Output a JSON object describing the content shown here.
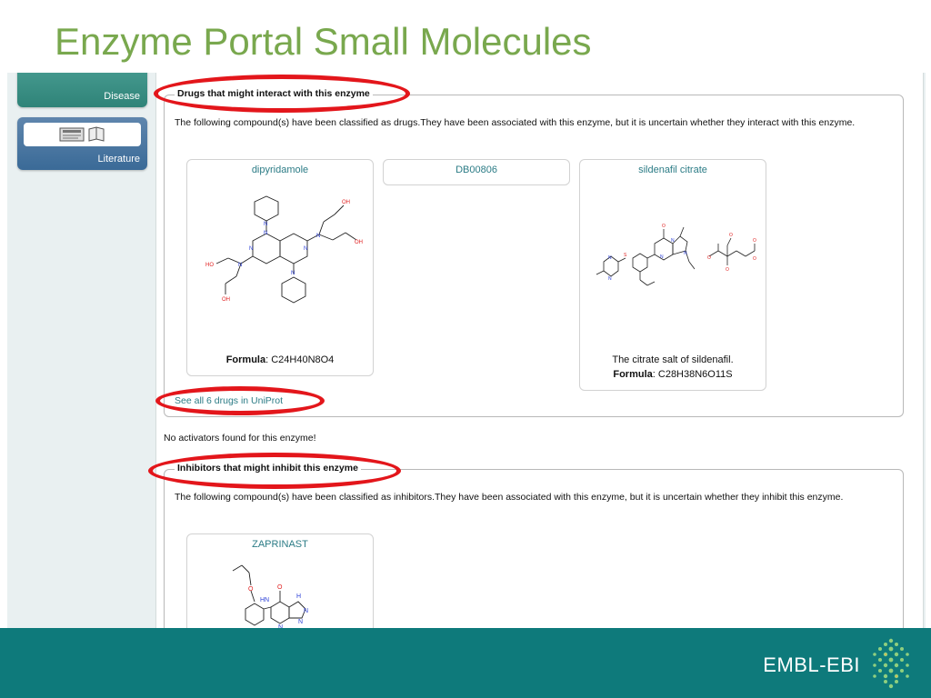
{
  "slide_title": "Enzyme Portal Small Molecules",
  "nav": {
    "disease_label": "Disease",
    "literature_label": "Literature"
  },
  "drugs_section": {
    "legend": "Drugs that might interact with this enzyme",
    "description": "The following compound(s) have been classified as drugs.They have been associated with this enzyme, but it is uncertain whether they interact with this enzyme.",
    "cards": [
      {
        "name": "dipyridamole",
        "formula_label": "Formula",
        "formula": ": C24H40N8O4"
      },
      {
        "name": "DB00806"
      },
      {
        "name": "sildenafil citrate",
        "note": "The citrate salt of sildenafil.",
        "formula_label": "Formula",
        "formula": ": C28H38N6O11S"
      }
    ],
    "see_all_link": "See all 6 drugs in UniProt"
  },
  "activators_text": "No activators found for this enzyme!",
  "inhibitors_section": {
    "legend": "Inhibitors that might inhibit this enzyme",
    "description": "The following compound(s) have been classified as inhibitors.They have been associated with this enzyme, but it is uncertain whether they inhibit this enzyme.",
    "cards": [
      {
        "name": "ZAPRINAST"
      }
    ]
  },
  "molecule_labels": {
    "oh": "OH",
    "ho": "HO",
    "n": "N",
    "nh": "HN",
    "o": "O",
    "h": "H"
  },
  "footer": {
    "logo_text": "EMBL-EBI"
  },
  "colors": {
    "title": "#79a84e",
    "footer": "#0e7a7b",
    "highlight_oval": "#e3161b",
    "link": "#2c7c86"
  }
}
